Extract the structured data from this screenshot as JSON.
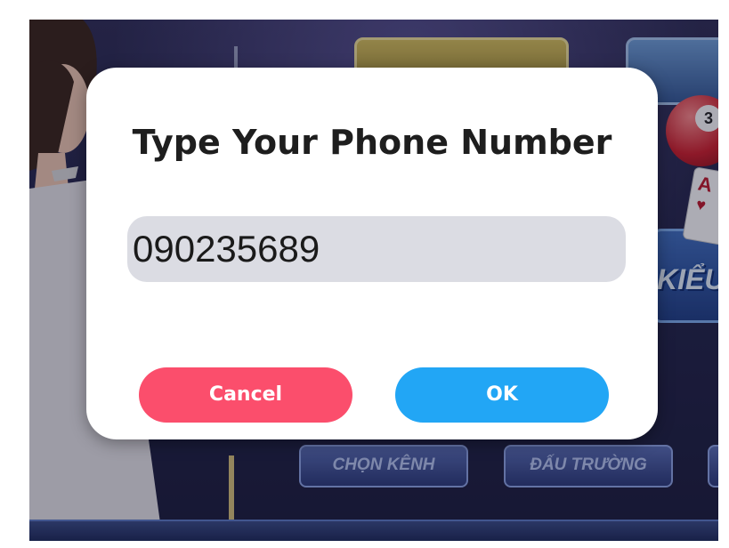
{
  "dialog": {
    "title": "Type Your Phone Number",
    "phone_value": "090235689",
    "cancel_label": "Cancel",
    "ok_label": "OK"
  },
  "background": {
    "nav_tiles": [
      "CHỌN KÊNH",
      "ĐẤU TRƯỜNG"
    ],
    "kieu_label": "KIỂU",
    "ball_number": "3",
    "card_rank": "A",
    "card_suit": "♥"
  },
  "colors": {
    "cancel_button": "#fb4e6c",
    "ok_button": "#22a6f5",
    "input_background": "#dbdce3",
    "dialog_background": "#ffffff"
  }
}
